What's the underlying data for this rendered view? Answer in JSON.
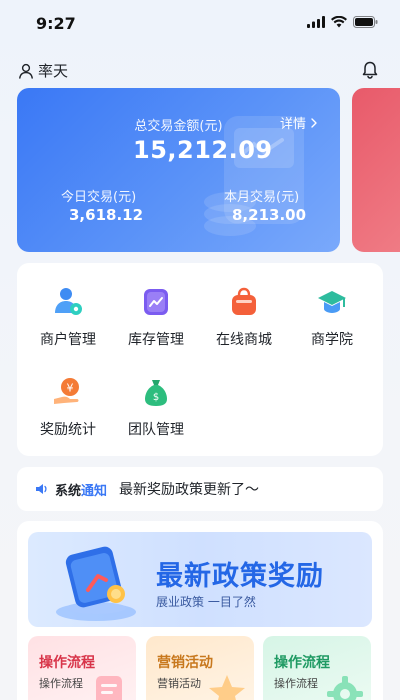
{
  "status_bar": {
    "time": "9:27"
  },
  "header": {
    "user_name": "率天"
  },
  "stats": {
    "total_label": "总交易金额(元)",
    "detail_label": "详情",
    "total_value": "15,212.09",
    "today_label": "今日交易(元)",
    "today_value": "3,618.12",
    "month_label": "本月交易(元)",
    "month_value": "8,213.00"
  },
  "menu": {
    "items": [
      {
        "label": "商户管理",
        "icon": "merchant-icon"
      },
      {
        "label": "库存管理",
        "icon": "inventory-icon"
      },
      {
        "label": "在线商城",
        "icon": "shop-bag-icon"
      },
      {
        "label": "商学院",
        "icon": "graduation-cap-icon"
      },
      {
        "label": "奖励统计",
        "icon": "reward-coin-icon"
      },
      {
        "label": "团队管理",
        "icon": "team-money-bag-icon"
      }
    ]
  },
  "notice": {
    "tag_part1": "系统",
    "tag_part2": "通知",
    "text": "最新奖励政策更新了～"
  },
  "banner": {
    "title": "最新政策奖励",
    "subtitle": "展业政策 一目了然"
  },
  "tiles": [
    {
      "title": "操作流程",
      "subtitle": "操作流程"
    },
    {
      "title": "营销活动",
      "subtitle": "营销活动"
    },
    {
      "title": "操作流程",
      "subtitle": "操作流程"
    }
  ],
  "colors": {
    "accent": "#3a78f5",
    "card_red": "#e85a6a",
    "banner_title": "#2467e6"
  }
}
